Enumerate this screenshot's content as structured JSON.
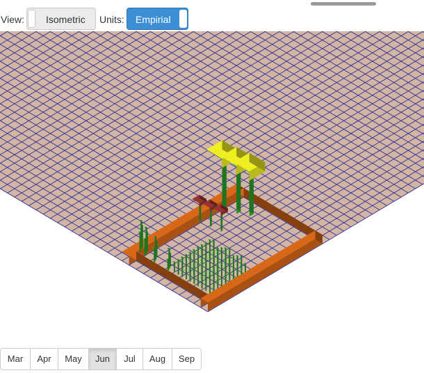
{
  "view": {
    "label": "View:",
    "value": "Isometric"
  },
  "units": {
    "label": "Units:",
    "value": "Empirial"
  },
  "months": [
    "Mar",
    "Apr",
    "May",
    "Jun",
    "Jul",
    "Aug",
    "Sep"
  ],
  "selected_month": "Jun",
  "colors": {
    "ground": "#d2b5a2",
    "grid_lines": "#2e2e9c",
    "bed_frame": "#d86818",
    "plant_green": "#33bb33",
    "flower_yellow": "#eeee22",
    "bloom_red": "#993333",
    "toggle_on": "#3c8fd5"
  }
}
